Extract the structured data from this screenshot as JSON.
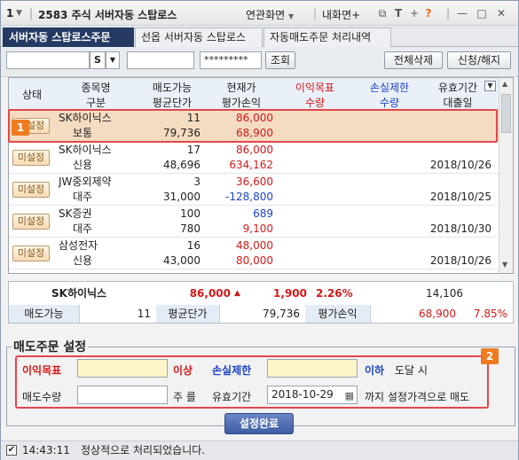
{
  "titlebar": {
    "window_no": "1",
    "title": "2583 주식 서버자동 스탑로스",
    "link_screen": "연관화면",
    "link_my": "내화면+"
  },
  "tabs": [
    {
      "label": "서버자동 스탑로스주문"
    },
    {
      "label": "선옵 서버자동 스탑로스"
    },
    {
      "label": "자동매도주문 처리내역"
    }
  ],
  "toolbar": {
    "account_value": "",
    "account_type": "S",
    "sub_value": "",
    "password_value": "*********",
    "query_label": "조회",
    "delete_all_label": "전체삭제",
    "apply_cancel_label": "신청/해지"
  },
  "grid": {
    "headers_top": [
      "상태",
      "종목명",
      "매도가능",
      "현재가",
      "이익목표",
      "손실제한",
      "유효기간"
    ],
    "headers_bottom": [
      "구분",
      "평균단가",
      "평가손익",
      "수량",
      "수량",
      "대출일"
    ],
    "rows": [
      {
        "status": "미설정",
        "name": "SK하이닉스",
        "sellable": "11",
        "price": "86,000",
        "type": "보통",
        "avg": "79,736",
        "pnl": "68,900",
        "expiry": ""
      },
      {
        "status": "미설정",
        "name": "SK하이닉스",
        "sellable": "17",
        "price": "86,000",
        "type": "신용",
        "avg": "48,696",
        "pnl": "634,162",
        "expiry": "2018/10/26"
      },
      {
        "status": "미설정",
        "name": "JW중외제약",
        "sellable": "3",
        "price": "36,600",
        "type": "대주",
        "avg": "31,000",
        "pnl": "-128,800",
        "expiry": "2018/10/25"
      },
      {
        "status": "미설정",
        "name": "SK증권",
        "sellable": "100",
        "price": "689",
        "type": "대주",
        "avg": "780",
        "pnl": "9,100",
        "expiry": "2018/10/30"
      },
      {
        "status": "미설정",
        "name": "삼성전자",
        "sellable": "16",
        "price": "48,000",
        "type": "신용",
        "avg": "43,000",
        "pnl": "80,000",
        "expiry": "2018/10/26"
      }
    ]
  },
  "info": {
    "stock_name": "SK하이닉스",
    "price": "86,000",
    "arrow": "▲",
    "change": "1,900",
    "change_pct": "2.26%",
    "volume": "14,106",
    "sellable_label": "매도가능",
    "sellable_value": "11",
    "avg_label": "평균단가",
    "avg_value": "79,736",
    "pnl_label": "평가손익",
    "pnl_value": "68,900",
    "pnl_pct": "7.85%"
  },
  "order": {
    "section_title": "매도주문 설정",
    "profit_label": "이익목표",
    "over_label": "이상",
    "loss_label": "손실제한",
    "under_label": "이하",
    "reach_label": "도달 시",
    "qty_label": "매도수량",
    "qty_unit": "주 를",
    "expiry_label": "유효기간",
    "expiry_value": "2018-10-29",
    "tail_label": "까지  설정가격으로 매도",
    "complete_label": "설정완료"
  },
  "badges": {
    "b1": "1",
    "b2": "2"
  },
  "status_bar": {
    "time": "14:43:11",
    "message": "정상적으로 처리되었습니다."
  },
  "colors": {
    "accent_tab": "#243a63",
    "highlight_row": "#f4dcc2",
    "red": "#d11a1a",
    "blue": "#1d43c9",
    "badge": "#f07b1f"
  }
}
